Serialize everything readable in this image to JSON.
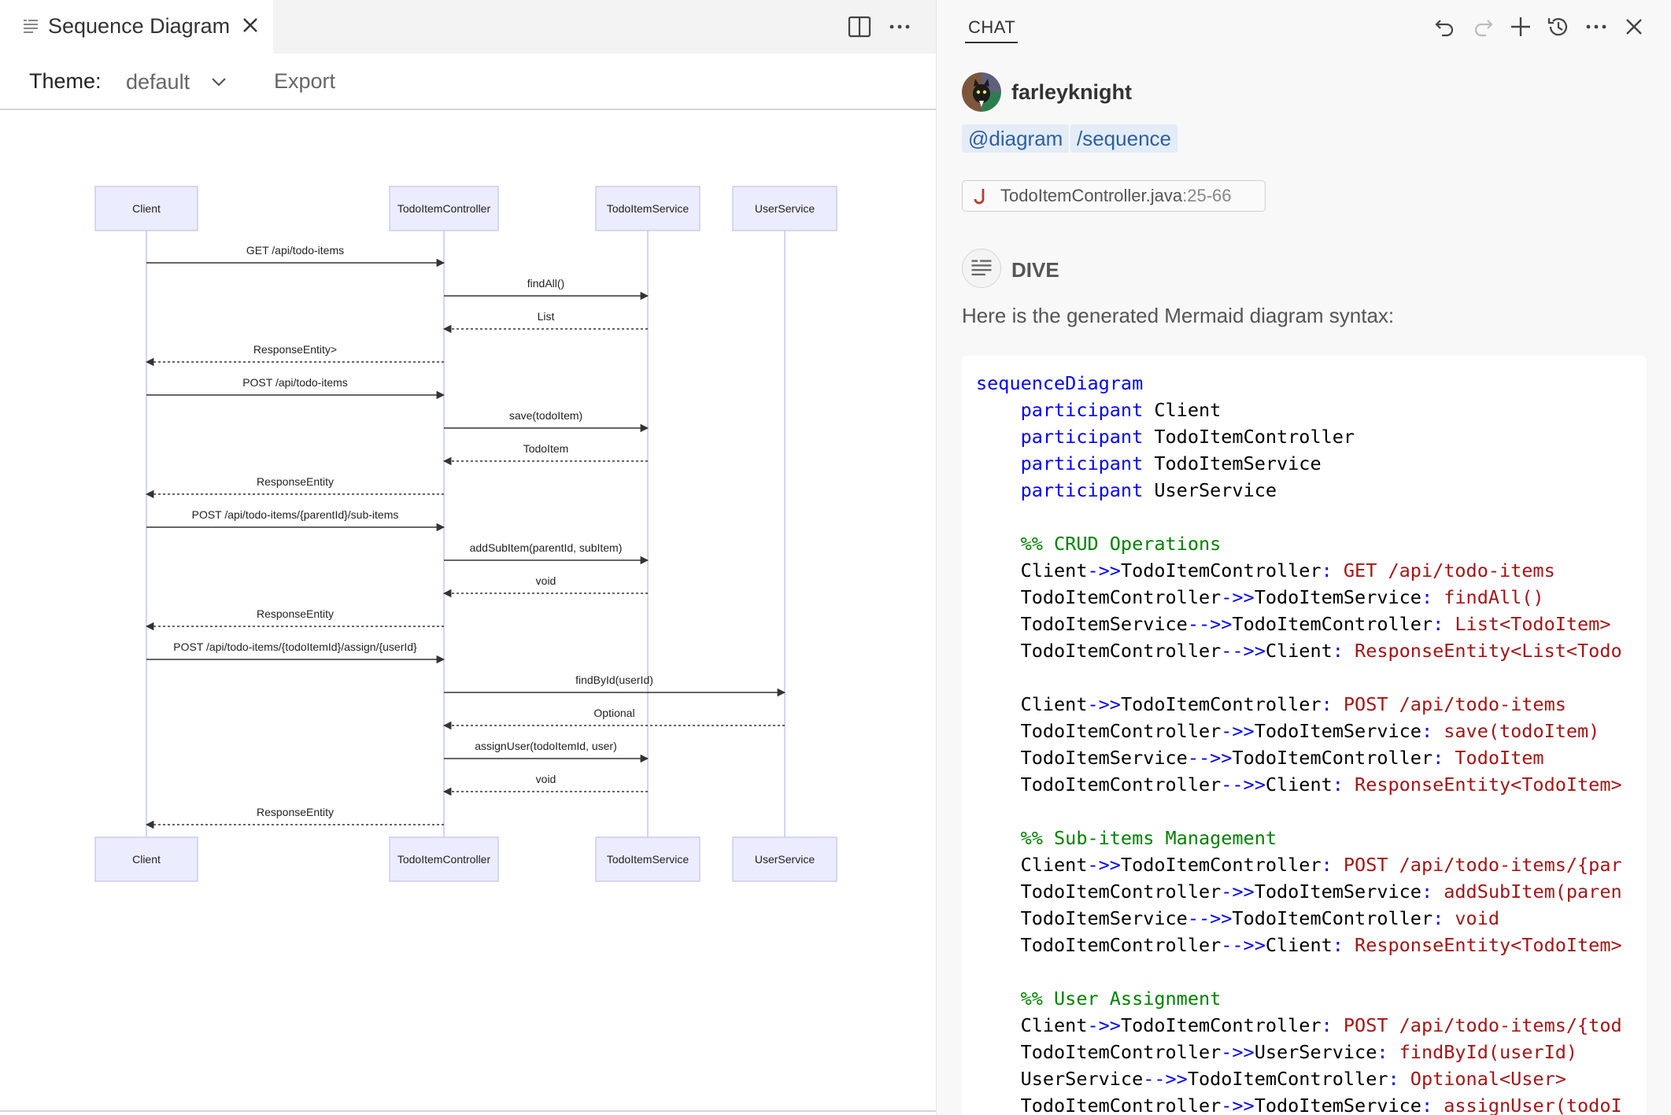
{
  "editor": {
    "tab_title": "Sequence Diagram",
    "toolbar": {
      "theme_label": "Theme:",
      "theme_value": "default",
      "export_label": "Export"
    }
  },
  "diagram": {
    "participants": [
      "Client",
      "TodoItemController",
      "TodoItemService",
      "UserService"
    ],
    "messages": [
      {
        "from": 0,
        "to": 1,
        "label": "GET /api/todo-items",
        "dashed": false
      },
      {
        "from": 1,
        "to": 2,
        "label": "findAll()",
        "dashed": false
      },
      {
        "from": 2,
        "to": 1,
        "label": "List",
        "dashed": true
      },
      {
        "from": 1,
        "to": 0,
        "label": "ResponseEntity>",
        "dashed": true
      },
      {
        "from": 0,
        "to": 1,
        "label": "POST /api/todo-items",
        "dashed": false
      },
      {
        "from": 1,
        "to": 2,
        "label": "save(todoItem)",
        "dashed": false
      },
      {
        "from": 2,
        "to": 1,
        "label": "TodoItem",
        "dashed": true
      },
      {
        "from": 1,
        "to": 0,
        "label": "ResponseEntity",
        "dashed": true
      },
      {
        "from": 0,
        "to": 1,
        "label": "POST /api/todo-items/{parentId}/sub-items",
        "dashed": false
      },
      {
        "from": 1,
        "to": 2,
        "label": "addSubItem(parentId, subItem)",
        "dashed": false
      },
      {
        "from": 2,
        "to": 1,
        "label": "void",
        "dashed": true
      },
      {
        "from": 1,
        "to": 0,
        "label": "ResponseEntity",
        "dashed": true
      },
      {
        "from": 0,
        "to": 1,
        "label": "POST /api/todo-items/{todoItemId}/assign/{userId}",
        "dashed": false
      },
      {
        "from": 1,
        "to": 3,
        "label": "findById(userId)",
        "dashed": false
      },
      {
        "from": 3,
        "to": 1,
        "label": "Optional",
        "dashed": true
      },
      {
        "from": 1,
        "to": 2,
        "label": "assignUser(todoItemId, user)",
        "dashed": false
      },
      {
        "from": 2,
        "to": 1,
        "label": "void",
        "dashed": true
      },
      {
        "from": 1,
        "to": 0,
        "label": "ResponseEntity",
        "dashed": true
      }
    ]
  },
  "chat": {
    "title": "CHAT",
    "user": {
      "name": "farleyknight"
    },
    "commands": [
      "@diagram",
      "/sequence"
    ],
    "file_ref": {
      "name": "TodoItemController.java",
      "lines": ":25-66"
    },
    "agent": {
      "name": "DIVE"
    },
    "message": "Here is the generated Mermaid diagram syntax:",
    "code_lines": [
      [
        {
          "t": "kw",
          "v": "sequenceDiagram"
        }
      ],
      [
        {
          "t": "kw",
          "v": "    participant"
        },
        {
          "t": "id",
          "v": " Client"
        }
      ],
      [
        {
          "t": "kw",
          "v": "    participant"
        },
        {
          "t": "id",
          "v": " TodoItemController"
        }
      ],
      [
        {
          "t": "kw",
          "v": "    participant"
        },
        {
          "t": "id",
          "v": " TodoItemService"
        }
      ],
      [
        {
          "t": "kw",
          "v": "    participant"
        },
        {
          "t": "id",
          "v": " UserService"
        }
      ],
      [],
      [
        {
          "t": "cm",
          "v": "    %% CRUD Operations"
        }
      ],
      [
        {
          "t": "id",
          "v": "    Client"
        },
        {
          "t": "ar",
          "v": "->>"
        },
        {
          "t": "id",
          "v": "TodoItemController"
        },
        {
          "t": "ar",
          "v": ":"
        },
        {
          "t": "msg",
          "v": " GET /api/todo-items"
        }
      ],
      [
        {
          "t": "id",
          "v": "    TodoItemController"
        },
        {
          "t": "ar",
          "v": "->>"
        },
        {
          "t": "id",
          "v": "TodoItemService"
        },
        {
          "t": "ar",
          "v": ":"
        },
        {
          "t": "msg",
          "v": " findAll()"
        }
      ],
      [
        {
          "t": "id",
          "v": "    TodoItemService"
        },
        {
          "t": "ar",
          "v": "-->>"
        },
        {
          "t": "id",
          "v": "TodoItemController"
        },
        {
          "t": "ar",
          "v": ":"
        },
        {
          "t": "msg",
          "v": " List<TodoItem>"
        }
      ],
      [
        {
          "t": "id",
          "v": "    TodoItemController"
        },
        {
          "t": "ar",
          "v": "-->>"
        },
        {
          "t": "id",
          "v": "Client"
        },
        {
          "t": "ar",
          "v": ":"
        },
        {
          "t": "msg",
          "v": " ResponseEntity<List<Todo"
        }
      ],
      [],
      [
        {
          "t": "id",
          "v": "    Client"
        },
        {
          "t": "ar",
          "v": "->>"
        },
        {
          "t": "id",
          "v": "TodoItemController"
        },
        {
          "t": "ar",
          "v": ":"
        },
        {
          "t": "msg",
          "v": " POST /api/todo-items"
        }
      ],
      [
        {
          "t": "id",
          "v": "    TodoItemController"
        },
        {
          "t": "ar",
          "v": "->>"
        },
        {
          "t": "id",
          "v": "TodoItemService"
        },
        {
          "t": "ar",
          "v": ":"
        },
        {
          "t": "msg",
          "v": " save(todoItem)"
        }
      ],
      [
        {
          "t": "id",
          "v": "    TodoItemService"
        },
        {
          "t": "ar",
          "v": "-->>"
        },
        {
          "t": "id",
          "v": "TodoItemController"
        },
        {
          "t": "ar",
          "v": ":"
        },
        {
          "t": "msg",
          "v": " TodoItem"
        }
      ],
      [
        {
          "t": "id",
          "v": "    TodoItemController"
        },
        {
          "t": "ar",
          "v": "-->>"
        },
        {
          "t": "id",
          "v": "Client"
        },
        {
          "t": "ar",
          "v": ":"
        },
        {
          "t": "msg",
          "v": " ResponseEntity<TodoItem>"
        }
      ],
      [],
      [
        {
          "t": "cm",
          "v": "    %% Sub-items Management"
        }
      ],
      [
        {
          "t": "id",
          "v": "    Client"
        },
        {
          "t": "ar",
          "v": "->>"
        },
        {
          "t": "id",
          "v": "TodoItemController"
        },
        {
          "t": "ar",
          "v": ":"
        },
        {
          "t": "msg",
          "v": " POST /api/todo-items/{par"
        }
      ],
      [
        {
          "t": "id",
          "v": "    TodoItemController"
        },
        {
          "t": "ar",
          "v": "->>"
        },
        {
          "t": "id",
          "v": "TodoItemService"
        },
        {
          "t": "ar",
          "v": ":"
        },
        {
          "t": "msg",
          "v": " addSubItem(paren"
        }
      ],
      [
        {
          "t": "id",
          "v": "    TodoItemService"
        },
        {
          "t": "ar",
          "v": "-->>"
        },
        {
          "t": "id",
          "v": "TodoItemController"
        },
        {
          "t": "ar",
          "v": ":"
        },
        {
          "t": "msg",
          "v": " void"
        }
      ],
      [
        {
          "t": "id",
          "v": "    TodoItemController"
        },
        {
          "t": "ar",
          "v": "-->>"
        },
        {
          "t": "id",
          "v": "Client"
        },
        {
          "t": "ar",
          "v": ":"
        },
        {
          "t": "msg",
          "v": " ResponseEntity<TodoItem>"
        }
      ],
      [],
      [
        {
          "t": "cm",
          "v": "    %% User Assignment"
        }
      ],
      [
        {
          "t": "id",
          "v": "    Client"
        },
        {
          "t": "ar",
          "v": "->>"
        },
        {
          "t": "id",
          "v": "TodoItemController"
        },
        {
          "t": "ar",
          "v": ":"
        },
        {
          "t": "msg",
          "v": " POST /api/todo-items/{tod"
        }
      ],
      [
        {
          "t": "id",
          "v": "    TodoItemController"
        },
        {
          "t": "ar",
          "v": "->>"
        },
        {
          "t": "id",
          "v": "UserService"
        },
        {
          "t": "ar",
          "v": ":"
        },
        {
          "t": "msg",
          "v": " findById(userId)"
        }
      ],
      [
        {
          "t": "id",
          "v": "    UserService"
        },
        {
          "t": "ar",
          "v": "-->>"
        },
        {
          "t": "id",
          "v": "TodoItemController"
        },
        {
          "t": "ar",
          "v": ":"
        },
        {
          "t": "msg",
          "v": " Optional<User>"
        }
      ],
      [
        {
          "t": "id",
          "v": "    TodoItemController"
        },
        {
          "t": "ar",
          "v": "->>"
        },
        {
          "t": "id",
          "v": "TodoItemService"
        },
        {
          "t": "ar",
          "v": ":"
        },
        {
          "t": "msg",
          "v": " assignUser(todoI"
        }
      ]
    ]
  },
  "icons": {
    "tab_icon": "preview-lines-icon",
    "close": "close-icon",
    "split": "split-editor-icon",
    "more": "more-ellipsis-icon",
    "undo": "undo-icon",
    "redo": "redo-icon",
    "new_chat": "plus-icon",
    "history": "history-icon",
    "java_file": "java-file-icon",
    "agent": "agent-icon"
  },
  "colors": {
    "participant_fill": "#ececff",
    "participant_stroke": "#c9c9ef",
    "lifeline": "#c9c9ef",
    "code_keyword": "#0000ff",
    "code_message": "#a31515",
    "code_comment": "#008000",
    "command_chip_bg": "#e3ecf7",
    "java_icon": "#c0392b"
  }
}
